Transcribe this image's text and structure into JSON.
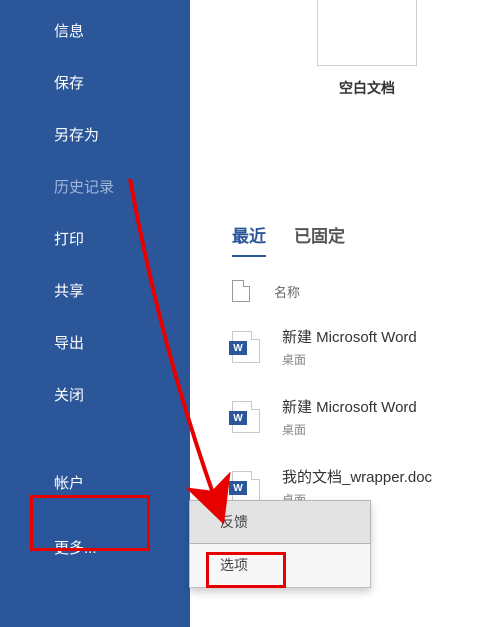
{
  "sidebar": {
    "items": [
      {
        "label": "信息"
      },
      {
        "label": "保存"
      },
      {
        "label": "另存为"
      },
      {
        "label": "历史记录",
        "disabled": true
      },
      {
        "label": "打印"
      },
      {
        "label": "共享"
      },
      {
        "label": "导出"
      },
      {
        "label": "关闭"
      }
    ],
    "account_label": "帐户",
    "more_label": "更多..."
  },
  "content": {
    "blank_doc": "空白文档",
    "tabs": {
      "recent": "最近",
      "pinned": "已固定"
    },
    "header_name": "名称",
    "files": [
      {
        "name": "新建 Microsoft Word",
        "loc": "桌面"
      },
      {
        "name": "新建 Microsoft Word",
        "loc": "桌面"
      },
      {
        "name": "我的文档_wrapper.doc",
        "loc": "桌面"
      }
    ]
  },
  "popup": {
    "feedback": "反馈",
    "options": "选项"
  },
  "word_badge": "W"
}
